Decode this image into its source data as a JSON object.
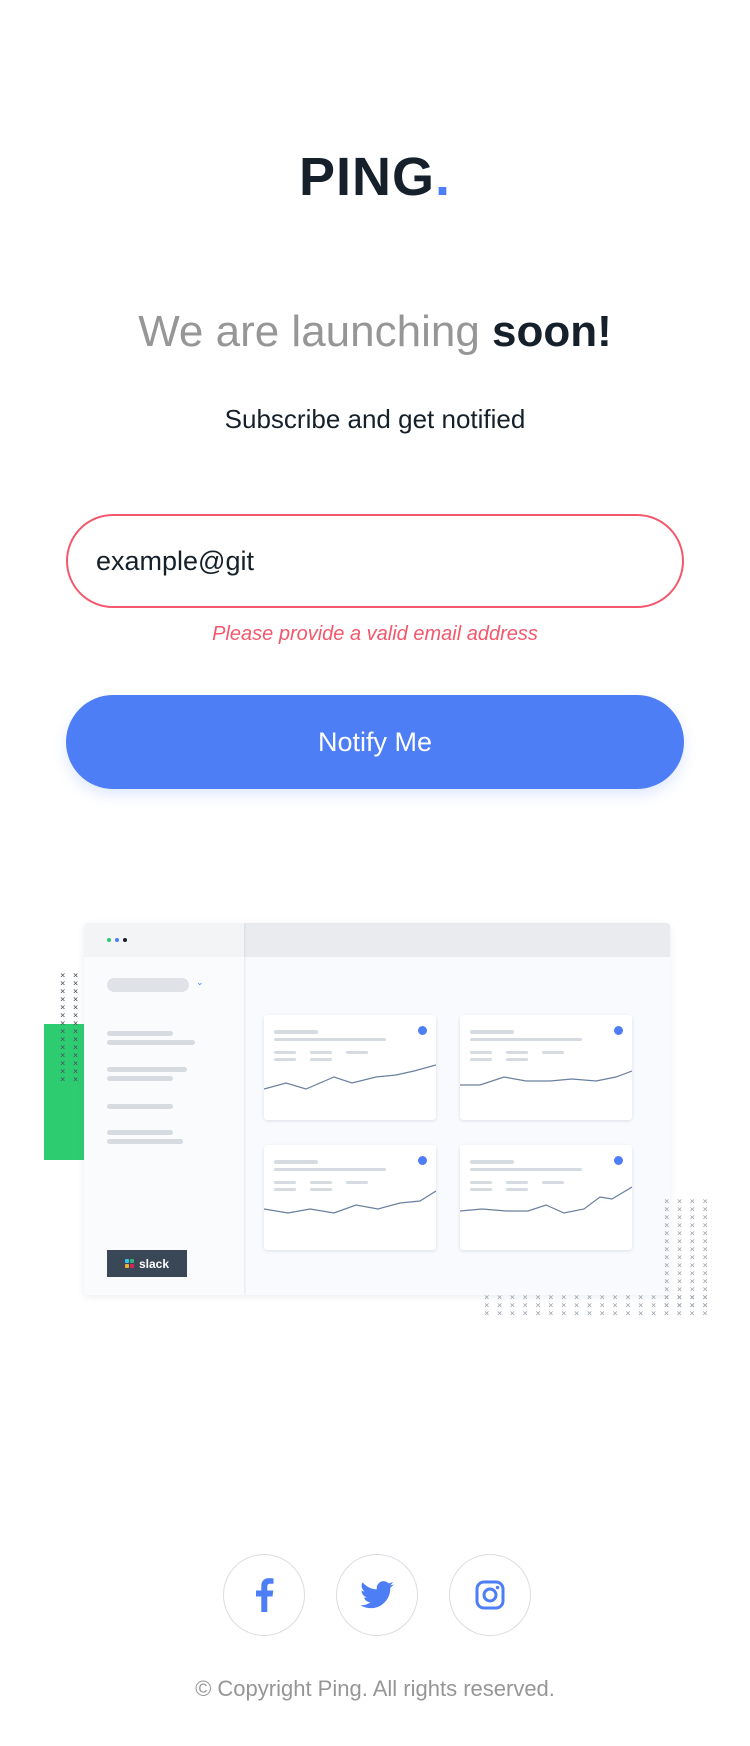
{
  "logo": {
    "text": "PING",
    "dot": "."
  },
  "headline": {
    "prefix": "We are launching ",
    "emphasis": "soon!"
  },
  "subtitle": "Subscribe and get notified",
  "form": {
    "email_value": "example@git",
    "error_text": "Please provide a valid email address",
    "submit_label": "Notify Me"
  },
  "illustration": {
    "badge_text": "slack"
  },
  "social": [
    {
      "name": "facebook",
      "icon": "facebook-icon"
    },
    {
      "name": "twitter",
      "icon": "twitter-icon"
    },
    {
      "name": "instagram",
      "icon": "instagram-icon"
    }
  ],
  "footer": {
    "copyright": "© Copyright Ping. All rights reserved."
  },
  "colors": {
    "accent": "#4d7ef5",
    "error": "#f4576c",
    "dark": "#15202a",
    "gray": "#969696",
    "green": "#2ecc71"
  }
}
